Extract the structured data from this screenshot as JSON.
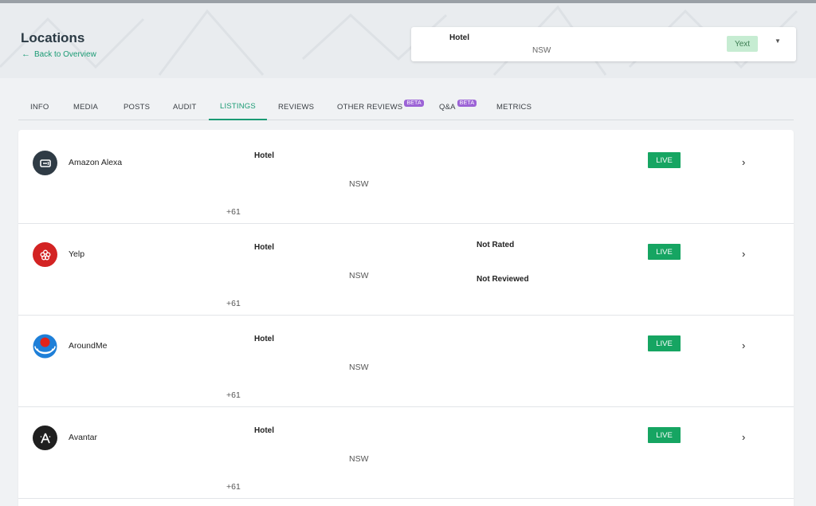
{
  "header": {
    "title": "Locations",
    "back_label": "Back to Overview",
    "location": {
      "name": "Hotel",
      "region": "NSW",
      "badge": "Yext"
    }
  },
  "tabs": [
    {
      "label": "INFO",
      "active": false
    },
    {
      "label": "MEDIA",
      "active": false
    },
    {
      "label": "POSTS",
      "active": false
    },
    {
      "label": "AUDIT",
      "active": false
    },
    {
      "label": "LISTINGS",
      "active": true
    },
    {
      "label": "REVIEWS",
      "active": false
    },
    {
      "label": "OTHER REVIEWS",
      "badge": "BETA",
      "active": false
    },
    {
      "label": "Q&A",
      "badge": "BETA",
      "active": false
    },
    {
      "label": "METRICS",
      "active": false
    }
  ],
  "listings": [
    {
      "publisher": "Amazon Alexa",
      "icon": "amazon-alexa-icon",
      "name": "Hotel",
      "state": "NSW",
      "phone": "+61",
      "status": "LIVE",
      "rating": "",
      "reviews": ""
    },
    {
      "publisher": "Yelp",
      "icon": "yelp-icon",
      "name": "Hotel",
      "state": "NSW",
      "phone": "+61",
      "status": "LIVE",
      "rating": "Not Rated",
      "reviews": "Not Reviewed"
    },
    {
      "publisher": "AroundMe",
      "icon": "aroundme-icon",
      "name": "Hotel",
      "state": "NSW",
      "phone": "+61",
      "status": "LIVE",
      "rating": "",
      "reviews": ""
    },
    {
      "publisher": "Avantar",
      "icon": "avantar-icon",
      "name": "Hotel",
      "state": "NSW",
      "phone": "+61",
      "status": "LIVE",
      "rating": "",
      "reviews": ""
    }
  ],
  "colors": {
    "accent": "#1a9b74",
    "live": "#16a562",
    "beta": "#9c63d6",
    "yelp": "#d32323"
  }
}
